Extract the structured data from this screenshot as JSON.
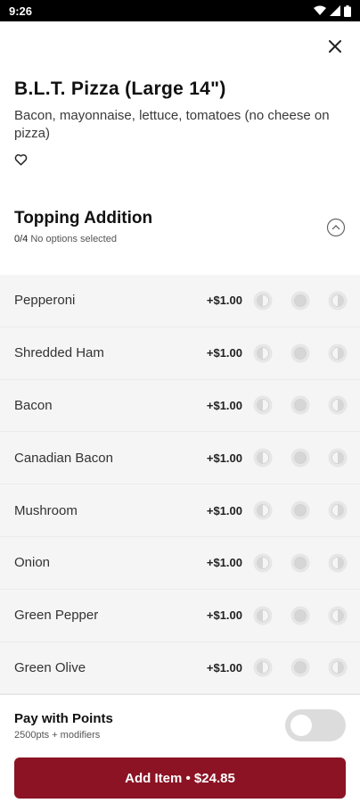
{
  "status_bar": {
    "time": "9:26"
  },
  "item": {
    "title": "B.L.T. Pizza (Large 14\")",
    "description": "Bacon, mayonnaise, lettuce, tomatoes (no cheese on pizza)"
  },
  "section": {
    "title": "Topping Addition",
    "count": "0/4",
    "status": "No options selected"
  },
  "options": [
    {
      "name": "Pepperoni",
      "price": "+$1.00"
    },
    {
      "name": "Shredded Ham",
      "price": "+$1.00"
    },
    {
      "name": "Bacon",
      "price": "+$1.00"
    },
    {
      "name": "Canadian Bacon",
      "price": "+$1.00"
    },
    {
      "name": "Mushroom",
      "price": "+$1.00"
    },
    {
      "name": "Onion",
      "price": "+$1.00"
    },
    {
      "name": "Green Pepper",
      "price": "+$1.00"
    },
    {
      "name": "Green Olive",
      "price": "+$1.00"
    }
  ],
  "points": {
    "title": "Pay with Points",
    "subtitle": "2500pts + modifiers"
  },
  "add_button": {
    "label": "Add Item • $24.85"
  },
  "colors": {
    "accent": "#8b1324",
    "options_bg": "#f5f5f5"
  }
}
